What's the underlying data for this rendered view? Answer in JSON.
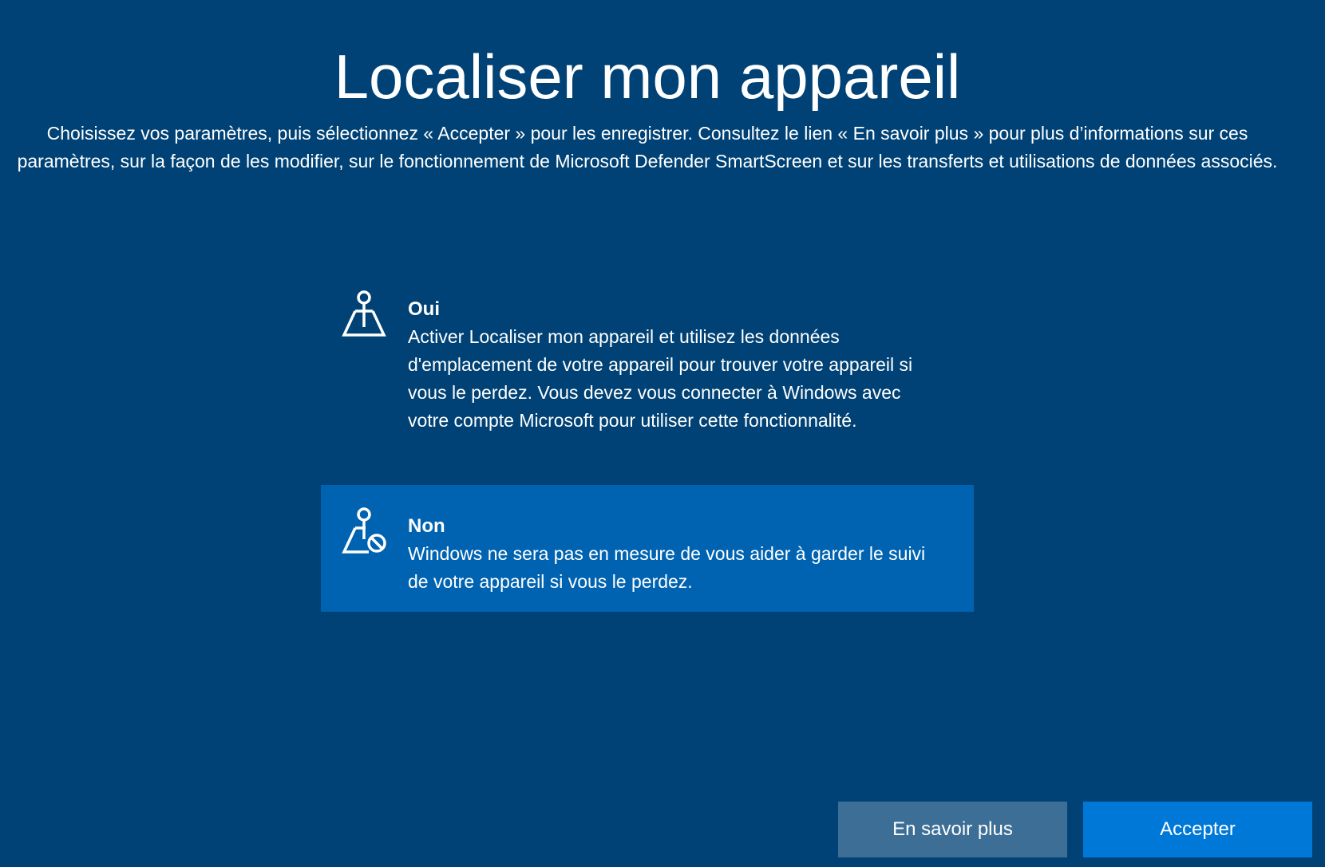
{
  "header": {
    "title": "Localiser mon appareil",
    "description": "Choisissez vos paramètres, puis sélectionnez « Accepter » pour les enregistrer. Consultez le lien « En savoir plus » pour plus d’informations sur ces paramètres, sur la façon de les modifier, sur le fonctionnement de Microsoft Defender SmartScreen et sur les transferts et utilisations de données associés."
  },
  "options": [
    {
      "title": "Oui",
      "description": "Activer Localiser mon appareil et utilisez les données d'emplacement de votre appareil pour trouver votre appareil si vous le perdez. Vous devez vous connecter à Windows avec votre compte Microsoft pour utiliser cette fonctionnalité.",
      "icon": "map-pin-icon",
      "selected": false
    },
    {
      "title": "Non",
      "description": "Windows ne sera pas en mesure de vous aider à garder le suivi de votre appareil si vous le perdez.",
      "icon": "map-pin-blocked-icon",
      "selected": true
    }
  ],
  "buttons": {
    "learn_more": "En savoir plus",
    "accept": "Accepter"
  },
  "colors": {
    "background": "#004275",
    "selected_option": "#0063b1",
    "secondary_button": "#3d6f96",
    "primary_button": "#0078d7"
  }
}
